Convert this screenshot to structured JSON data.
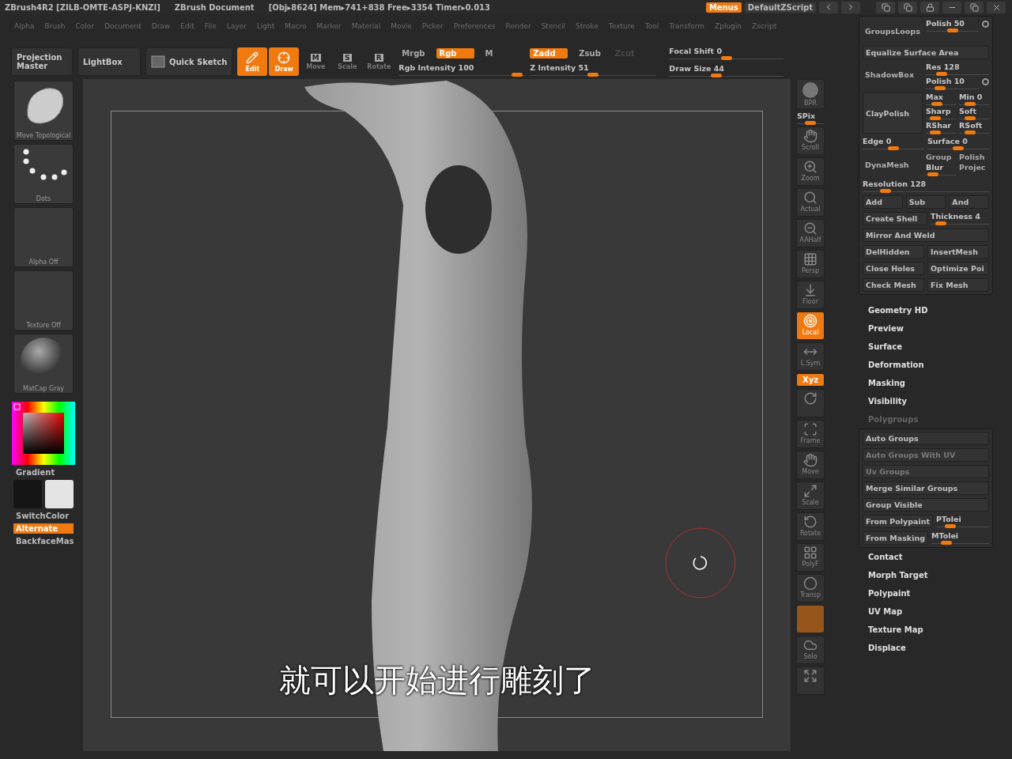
{
  "title_bar": {
    "segments": [
      "ZBrush4R2 [ZILB-OMTE-ASPJ-KNZI]",
      "ZBrush Document",
      "[Obj▸8624] Mem▸741+838 Free▸3354 Timer▸0.013"
    ],
    "buttons": [
      {
        "label": "Menus",
        "selected": true
      },
      {
        "label": "DefaultZScript",
        "selected": false
      }
    ]
  },
  "menus": [
    "Alpha",
    "Brush",
    "Color",
    "Document",
    "Draw",
    "Edit",
    "File",
    "Layer",
    "Light",
    "Macro",
    "Marker",
    "Material",
    "Movie",
    "Picker",
    "Preferences",
    "Render",
    "Stencil",
    "Stroke",
    "Texture",
    "Tool",
    "Transform",
    "Zplugin",
    "Zscript"
  ],
  "toolbar": {
    "buttons": [
      {
        "kind": "text",
        "label": "Projection Master"
      },
      {
        "kind": "text",
        "label": "LightBox"
      },
      {
        "kind": "sketch",
        "label": "Quick Sketch"
      }
    ],
    "modes": [
      {
        "kind": "edit",
        "label": "Edit",
        "selected": true
      },
      {
        "kind": "draw",
        "label": "Draw",
        "selected": true
      },
      {
        "kind": "move",
        "label": "Move",
        "key": "M",
        "selected": false
      },
      {
        "kind": "scale",
        "label": "Scale",
        "key": "S",
        "selected": false
      },
      {
        "kind": "rotate",
        "label": "Rotate",
        "key": "R",
        "selected": false
      }
    ],
    "color_modes": [
      {
        "label": "Mrgb",
        "selected": false
      },
      {
        "label": "Rgb",
        "selected": true
      },
      {
        "label": "M",
        "selected": false
      }
    ],
    "rgb_intensity": {
      "label": "Rgb Intensity 100",
      "level": 0.98
    },
    "z_modes": [
      {
        "label": "Zadd",
        "selected": true,
        "disabled": false
      },
      {
        "label": "Zsub",
        "selected": false,
        "disabled": false
      },
      {
        "label": "Zcut",
        "selected": false,
        "disabled": true
      }
    ],
    "z_intensity": {
      "label": "Z Intensity 51",
      "level": 0.5
    },
    "focal_shift": {
      "label": "Focal Shift 0",
      "level": 0.5
    },
    "draw_size": {
      "label": "Draw Size 44",
      "level": 0.4
    }
  },
  "left_shelf": {
    "thumbs": [
      {
        "kind": "brush",
        "label": "Move Topological"
      },
      {
        "kind": "stroke",
        "label": "Dots"
      },
      {
        "kind": "alpha",
        "label": "Alpha Off"
      },
      {
        "kind": "texture",
        "label": "Texture Off"
      },
      {
        "kind": "material",
        "label": "MatCap Gray"
      }
    ],
    "gradient": "Gradient",
    "switch_color": "SwitchColor",
    "alternate": {
      "label": "Alternate",
      "on": true
    },
    "backface": "BackfaceMas"
  },
  "canvas": {
    "subtitle": "就可以开始进行雕刻了"
  },
  "right_shelf": [
    {
      "kind": "bpr",
      "label": "BPR",
      "selected": false
    },
    {
      "kind": "spix",
      "label": "SPix",
      "level": 0.5
    },
    {
      "kind": "scroll",
      "label": "Scroll",
      "selected": false
    },
    {
      "kind": "zoom",
      "label": "Zoom",
      "selected": false
    },
    {
      "kind": "actual",
      "label": "Actual",
      "selected": false
    },
    {
      "kind": "aahalf",
      "label": "AAHalf",
      "selected": false
    },
    {
      "kind": "persp",
      "label": "Persp",
      "selected": false
    },
    {
      "kind": "floor",
      "label": "Floor",
      "selected": false
    },
    {
      "kind": "local",
      "label": "Local",
      "selected": true
    },
    {
      "kind": "lsym",
      "label": "L.Sym",
      "selected": false
    },
    {
      "kind": "xyz",
      "label": "Xyz",
      "selected": true
    },
    {
      "kind": "axes",
      "selected": false
    },
    {
      "kind": "frame",
      "label": "Frame",
      "selected": false
    },
    {
      "kind": "move",
      "label": "Move",
      "selected": false
    },
    {
      "kind": "scale",
      "label": "Scale",
      "selected": false
    },
    {
      "kind": "rotate",
      "label": "Rotate",
      "selected": false
    },
    {
      "kind": "polyf",
      "label": "PolyF",
      "selected": false
    },
    {
      "kind": "transp",
      "label": "Transp",
      "selected": false
    },
    {
      "kind": "ghost",
      "selected": true
    },
    {
      "kind": "solo",
      "label": "Solo",
      "selected": false
    },
    {
      "kind": "fit",
      "selected": false
    }
  ],
  "tool_palette": {
    "geometry_rows": [
      {
        "kind": "split",
        "left": {
          "kind": "label",
          "label": "GroupsLoops"
        },
        "right": [
          [
            {
              "kind": "dial",
              "label": "Polish 50",
              "level": 0.5
            }
          ]
        ]
      },
      {
        "kind": "row",
        "items": [
          {
            "kind": "button",
            "label": "Equalize Surface Area"
          }
        ]
      },
      {
        "kind": "split",
        "left": {
          "kind": "label",
          "label": "ShadowBox"
        },
        "right": [
          [
            {
              "kind": "slider",
              "label": "Res 128",
              "level": 0.2
            }
          ],
          [
            {
              "kind": "dial",
              "label": "Polish 10",
              "level": 0.2
            }
          ]
        ]
      },
      {
        "kind": "split",
        "left": {
          "kind": "button",
          "label": "ClayPolish"
        },
        "right": [
          [
            {
              "kind": "slider",
              "label": "Max",
              "level": 0.3
            },
            {
              "kind": "slider",
              "label": "Min 0",
              "level": 0.3
            }
          ],
          [
            {
              "kind": "slider",
              "label": "Sharp",
              "level": 0.2
            },
            {
              "kind": "slider",
              "label": "Soft",
              "level": 0.3
            }
          ],
          [
            {
              "kind": "slider",
              "label": "RShar",
              "level": 0.2
            },
            {
              "kind": "slider",
              "label": "RSoft",
              "level": 0.3
            }
          ]
        ]
      },
      {
        "kind": "row",
        "items": [
          {
            "kind": "slider",
            "label": "Edge 0",
            "level": 0.5
          },
          {
            "kind": "slider",
            "label": "Surface 0",
            "level": 0.5
          }
        ]
      },
      {
        "kind": "split",
        "left": {
          "kind": "label",
          "label": "DynaMesh"
        },
        "right": [
          [
            {
              "kind": "toggle",
              "label": "Group"
            },
            {
              "kind": "toggle",
              "label": "Polish"
            }
          ],
          [
            {
              "kind": "slider",
              "label": "Blur",
              "level": 0.1
            },
            {
              "kind": "toggle",
              "label": "Projec"
            }
          ]
        ]
      },
      {
        "kind": "row",
        "items": [
          {
            "kind": "slider",
            "label": "Resolution 128",
            "level": 0.15
          }
        ]
      },
      {
        "kind": "row",
        "items": [
          {
            "kind": "button",
            "label": "Add"
          },
          {
            "kind": "button",
            "label": "Sub"
          },
          {
            "kind": "button",
            "label": "And"
          }
        ]
      },
      {
        "kind": "row",
        "items": [
          {
            "kind": "button",
            "label": "Create Shell"
          },
          {
            "kind": "slider",
            "label": "Thickness 4",
            "level": 0.1
          }
        ]
      },
      {
        "kind": "row",
        "items": [
          {
            "kind": "button",
            "label": "Mirror And Weld"
          }
        ]
      },
      {
        "kind": "row",
        "items": [
          {
            "kind": "button",
            "label": "DelHidden"
          },
          {
            "kind": "button",
            "label": "InsertMesh"
          }
        ]
      },
      {
        "kind": "row",
        "items": [
          {
            "kind": "button",
            "label": "Close Holes"
          },
          {
            "kind": "button",
            "label": "Optimize Poi"
          }
        ]
      },
      {
        "kind": "row",
        "items": [
          {
            "kind": "button",
            "label": "Check Mesh"
          },
          {
            "kind": "button",
            "label": "Fix Mesh"
          }
        ]
      }
    ],
    "subpalettes": [
      {
        "label": "Geometry HD",
        "expanded": false
      },
      {
        "label": "Preview",
        "expanded": false
      },
      {
        "label": "Surface",
        "expanded": false
      },
      {
        "label": "Deformation",
        "expanded": false
      },
      {
        "label": "Masking",
        "expanded": false
      },
      {
        "label": "Visibility",
        "expanded": false
      },
      {
        "label": "Polygroups",
        "expanded": true,
        "rows": [
          {
            "kind": "row",
            "items": [
              {
                "kind": "button",
                "label": "Auto Groups"
              }
            ]
          },
          {
            "kind": "row",
            "items": [
              {
                "kind": "button",
                "label": "Auto Groups With UV",
                "disabled": true
              }
            ]
          },
          {
            "kind": "row",
            "items": [
              {
                "kind": "button",
                "label": "Uv Groups",
                "disabled": true
              }
            ]
          },
          {
            "kind": "row",
            "items": [
              {
                "kind": "button",
                "label": "Merge Similar Groups"
              }
            ]
          },
          {
            "kind": "row",
            "items": [
              {
                "kind": "button",
                "label": "Group Visible"
              }
            ]
          },
          {
            "kind": "row",
            "items": [
              {
                "kind": "button",
                "label": "From Polypaint"
              },
              {
                "kind": "slider",
                "label": "PTolei",
                "level": 0.2
              }
            ]
          },
          {
            "kind": "row",
            "items": [
              {
                "kind": "button",
                "label": "From Masking"
              },
              {
                "kind": "slider",
                "label": "MTolei",
                "level": 0.2
              }
            ]
          }
        ]
      },
      {
        "label": "Contact",
        "expanded": false
      },
      {
        "label": "Morph Target",
        "expanded": false
      },
      {
        "label": "Polypaint",
        "expanded": false
      },
      {
        "label": "UV Map",
        "expanded": false
      },
      {
        "label": "Texture Map",
        "expanded": false
      },
      {
        "label": "Displace",
        "expanded": false
      }
    ]
  }
}
